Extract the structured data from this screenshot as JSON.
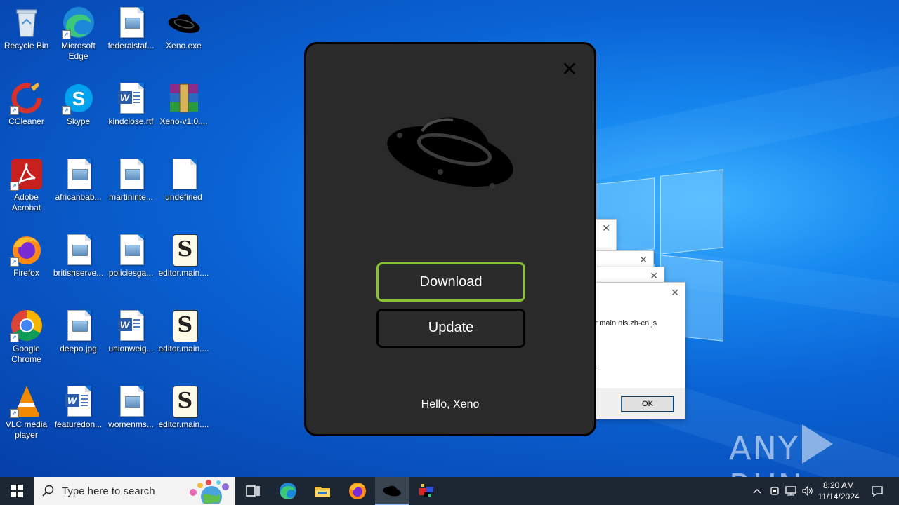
{
  "desktop": {
    "icons": [
      {
        "label": "Recycle Bin"
      },
      {
        "label": "Microsoft Edge"
      },
      {
        "label": "federalstaf..."
      },
      {
        "label": "Xeno.exe"
      },
      {
        "label": "CCleaner"
      },
      {
        "label": "Skype"
      },
      {
        "label": "kindclose.rtf"
      },
      {
        "label": "Xeno-v1.0...."
      },
      {
        "label": "Adobe Acrobat"
      },
      {
        "label": "africanbab..."
      },
      {
        "label": "martininte..."
      },
      {
        "label": "undefined"
      },
      {
        "label": "Firefox"
      },
      {
        "label": "britishserve..."
      },
      {
        "label": "policiesga..."
      },
      {
        "label": "editor.main...."
      },
      {
        "label": "Google Chrome"
      },
      {
        "label": "deepo.jpg"
      },
      {
        "label": "unionweig..."
      },
      {
        "label": "editor.main...."
      },
      {
        "label": "VLC media player"
      },
      {
        "label": "featuredon..."
      },
      {
        "label": "womenms..."
      },
      {
        "label": "editor.main...."
      }
    ]
  },
  "background_dialog": {
    "text1": "or.main.nls.zh-cn.js",
    "text2": "r",
    "ok_label": "OK"
  },
  "xeno_dialog": {
    "close_glyph": "✕",
    "download_label": "Download",
    "update_label": "Update",
    "greeting": "Hello, Xeno",
    "accent_color": "#86c232",
    "background_color": "#2a2a2a"
  },
  "watermark": {
    "left": "ANY",
    "right": "RUN"
  },
  "taskbar": {
    "search_placeholder": "Type here to search",
    "time": "8:20 AM",
    "date": "11/14/2024",
    "pinned": [
      "task-view-icon",
      "edge-icon",
      "file-explorer-icon",
      "firefox-icon",
      "xeno-icon",
      "app-icon"
    ]
  }
}
